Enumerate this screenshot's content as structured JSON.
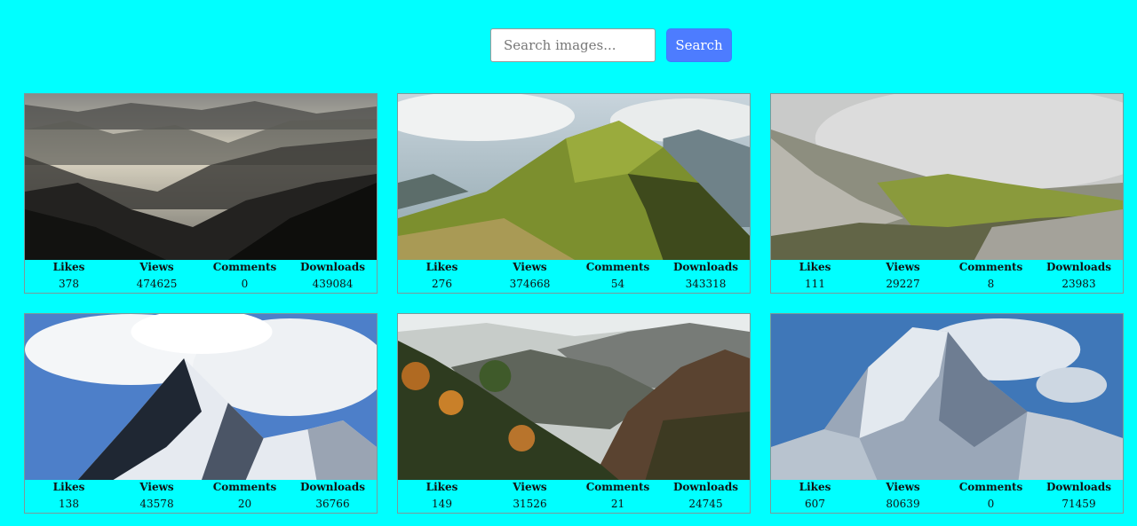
{
  "search": {
    "placeholder": "Search images...",
    "button_label": "Search"
  },
  "stat_labels": {
    "likes": "Likes",
    "views": "Views",
    "comments": "Comments",
    "downloads": "Downloads"
  },
  "cards": [
    {
      "image": "misty-mountain-valley-image",
      "likes": "378",
      "views": "474625",
      "comments": "0",
      "downloads": "439084"
    },
    {
      "image": "green-ridge-mountain-image",
      "likes": "276",
      "views": "374668",
      "comments": "54",
      "downloads": "343318"
    },
    {
      "image": "foggy-alpine-meadow-image",
      "likes": "111",
      "views": "29227",
      "comments": "8",
      "downloads": "23983"
    },
    {
      "image": "snowy-peak-clouds-image",
      "likes": "138",
      "views": "43578",
      "comments": "20",
      "downloads": "36766"
    },
    {
      "image": "autumn-forest-canyon-image",
      "likes": "149",
      "views": "31526",
      "comments": "21",
      "downloads": "24745"
    },
    {
      "image": "rocky-snow-mountain-image",
      "likes": "607",
      "views": "80639",
      "comments": "0",
      "downloads": "71459"
    }
  ],
  "colors": {
    "background": "#00ffff",
    "button": "#4d7cff"
  }
}
